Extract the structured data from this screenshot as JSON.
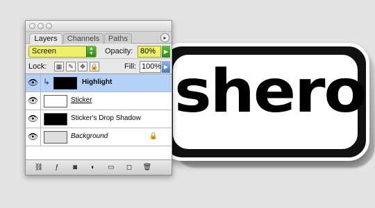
{
  "artwork": {
    "text": "shero"
  },
  "panel": {
    "tabs": [
      {
        "label": "Layers",
        "active": true
      },
      {
        "label": "Channels",
        "active": false
      },
      {
        "label": "Paths",
        "active": false
      }
    ],
    "menu_icon": "▸",
    "blend_mode": "Screen",
    "opacity_label": "Opacity:",
    "opacity_value": "80%",
    "lock_label": "Lock:",
    "fill_label": "Fill:",
    "fill_value": "100%",
    "layers": [
      {
        "name": "Highlight",
        "selected": true,
        "clipped": true
      },
      {
        "name": "Sticker",
        "selected": false
      },
      {
        "name": "Sticker's Drop Shadow",
        "selected": false
      },
      {
        "name": "Background",
        "selected": false,
        "locked": true
      }
    ],
    "bottom_icons": [
      "link-icon",
      "fx-icon",
      "mask-icon",
      "adjustment-icon",
      "folder-icon",
      "new-layer-icon",
      "trash-icon"
    ]
  }
}
